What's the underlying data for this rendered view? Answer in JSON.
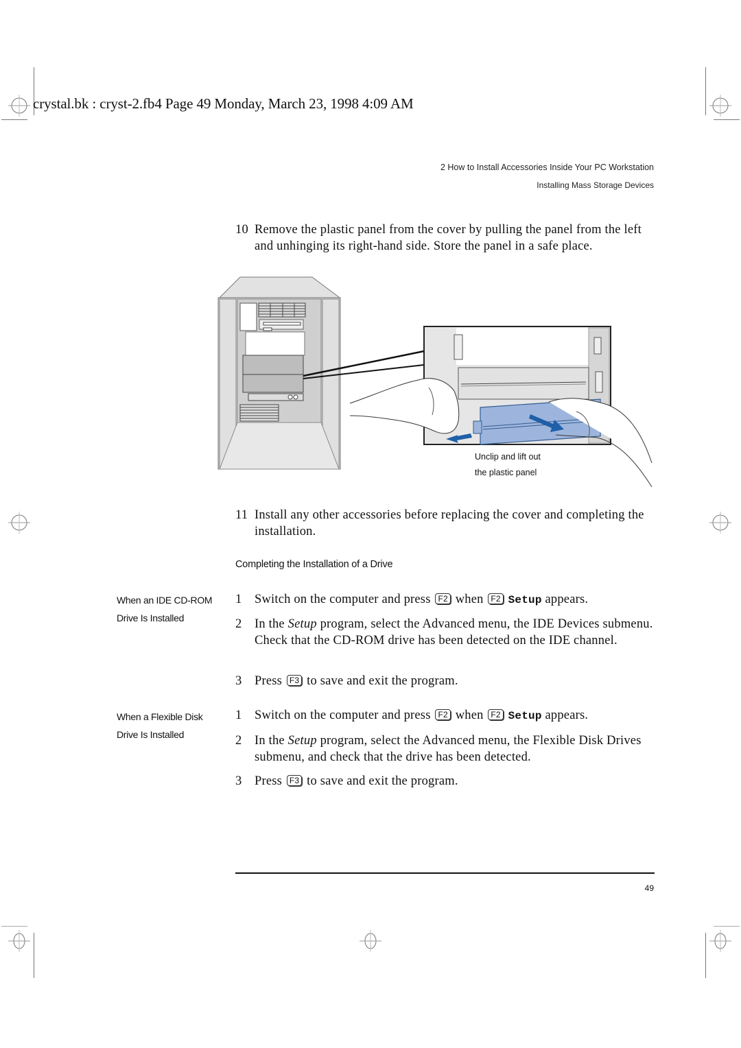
{
  "slug": {
    "text": "crystal.bk : cryst-2.fb4  Page 49  Monday, March 23, 1998  4:09 AM"
  },
  "running_head": {
    "chapter": "2   How to Install Accessories Inside Your PC Workstation",
    "section": "Installing Mass Storage Devices"
  },
  "steps_top": [
    {
      "number": "10",
      "text": "Remove the plastic panel from the cover by pulling the panel from the left and unhinging its right-hand side. Store the panel in a safe place."
    },
    {
      "number": "11",
      "text": "Install any other accessories before replacing the cover and completing the installation."
    }
  ],
  "figure": {
    "caption_line1": "Unclip and lift out",
    "caption_line2": "the plastic panel",
    "accent_color": "#1f5fa8",
    "panel_color": "#9db5dc"
  },
  "section_heading": "Completing the Installation of a Drive",
  "cdrom": {
    "side_heading_line1": "When an IDE CD-ROM",
    "side_heading_line2": "Drive Is Installed",
    "step1": {
      "number": "1",
      "before": "Switch on the computer and press",
      "key1": "F2",
      "middle": "when",
      "key2": "F2",
      "setup": "Setup",
      "after": "appears."
    },
    "step2": {
      "number": "2",
      "before": "In the",
      "italic": "Setup",
      "after": "program, select the Advanced menu, the IDE Devices submenu. Check that the CD-ROM drive has been detected on the IDE channel."
    },
    "step3": {
      "number": "3",
      "before": "Press",
      "key": "F3",
      "after": "to save and exit the program."
    }
  },
  "floppy": {
    "side_heading_line1": "When a Flexible Disk",
    "side_heading_line2": "Drive Is Installed",
    "step1": {
      "number": "1",
      "before": "Switch on the computer and press",
      "key1": "F2",
      "middle": "when",
      "key2": "F2",
      "setup": "Setup",
      "after": "appears."
    },
    "step2": {
      "number": "2",
      "before": "In the",
      "italic": "Setup",
      "after": "program, select the Advanced menu, the Flexible Disk Drives submenu, and check that the drive has been detected."
    },
    "step3": {
      "number": "3",
      "before": "Press",
      "key": "F3",
      "after": "to save and exit the program."
    }
  },
  "footer": {
    "page_number": "49"
  }
}
